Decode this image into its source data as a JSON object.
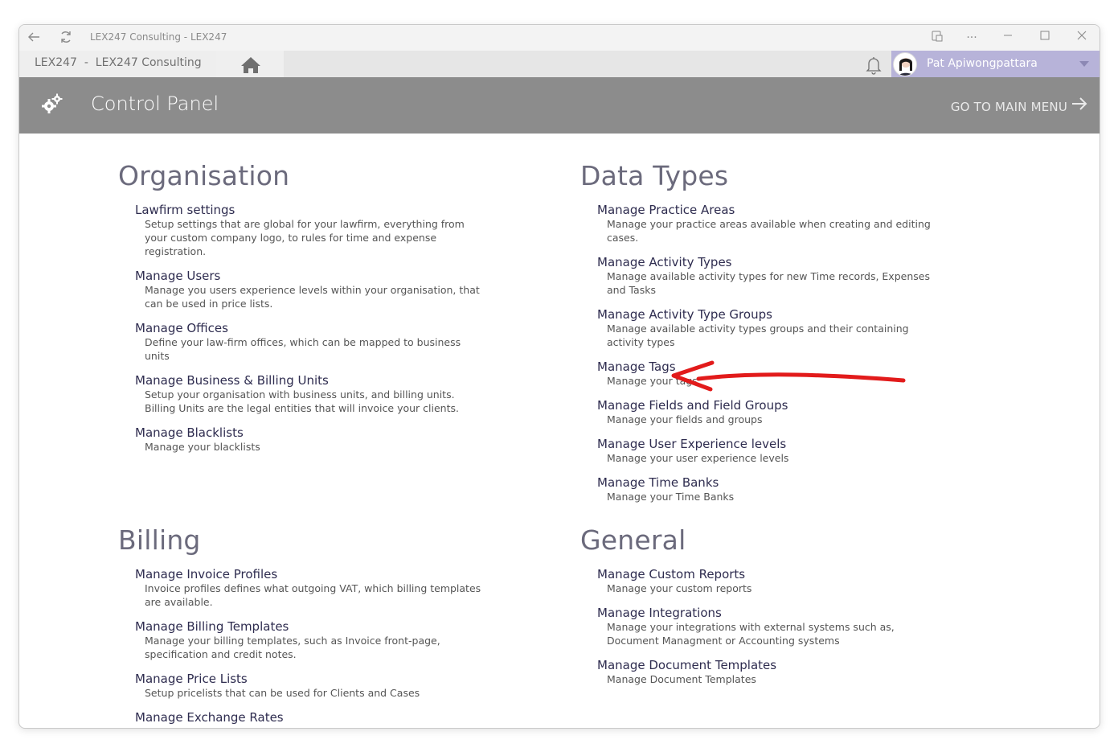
{
  "window": {
    "title": "LEX247 Consulting - LEX247"
  },
  "tabbar": {
    "tab_title": "LEX247  -  LEX247 Consulting",
    "user_name": "Pat Apiwongpattara"
  },
  "header": {
    "title": "Control Panel",
    "goto_label": "GO TO MAIN MENU"
  },
  "sections": {
    "organisation": {
      "title": "Organisation",
      "items": [
        {
          "label": "Lawfirm settings",
          "desc": "Setup settings that are global for your lawfirm, everything from your custom company logo, to rules for time and expense registration."
        },
        {
          "label": "Manage Users",
          "desc": "Manage you users experience levels within your organisation, that can be used in price lists."
        },
        {
          "label": "Manage Offices",
          "desc": "Define your law-firm offices, which can be mapped to business units"
        },
        {
          "label": "Manage Business & Billing Units",
          "desc": "Setup your organisation with business units, and billing units. Billing Units are the legal entities that will invoice your clients."
        },
        {
          "label": "Manage Blacklists",
          "desc": "Manage your blacklists"
        }
      ]
    },
    "data_types": {
      "title": "Data Types",
      "items": [
        {
          "label": "Manage Practice Areas",
          "desc": "Manage your practice areas available when creating and editing cases."
        },
        {
          "label": "Manage Activity Types",
          "desc": "Manage available activity types for new Time records, Expenses and Tasks"
        },
        {
          "label": "Manage Activity Type Groups",
          "desc": "Manage available activity types groups and their containing activity types"
        },
        {
          "label": "Manage Tags",
          "desc": "Manage your tags"
        },
        {
          "label": "Manage Fields and Field Groups",
          "desc": "Manage your fields and groups"
        },
        {
          "label": "Manage User Experience levels",
          "desc": "Manage your user experience levels"
        },
        {
          "label": "Manage Time Banks",
          "desc": "Manage your Time Banks"
        }
      ]
    },
    "billing": {
      "title": "Billing",
      "items": [
        {
          "label": "Manage Invoice Profiles",
          "desc": "Invoice profiles defines what outgoing VAT, which billing templates are available."
        },
        {
          "label": "Manage Billing Templates",
          "desc": "Manage your billing templates, such as Invoice front-page, specification and credit notes."
        },
        {
          "label": "Manage Price Lists",
          "desc": "Setup pricelists that can be used for Clients and Cases"
        },
        {
          "label": "Manage Exchange Rates",
          "desc": ""
        }
      ]
    },
    "general": {
      "title": "General",
      "items": [
        {
          "label": "Manage Custom Reports",
          "desc": "Manage your custom reports"
        },
        {
          "label": "Manage Integrations",
          "desc": "Manage your integrations with external systems such as, Document Managment or Accounting systems"
        },
        {
          "label": "Manage Document Templates",
          "desc": "Manage Document Templates"
        }
      ]
    }
  },
  "colors": {
    "header_bg": "#8c8c8c",
    "user_area_bg": "#b7b3d9",
    "link_color": "#2e2c4f",
    "annotation_red": "#e21b1b"
  }
}
